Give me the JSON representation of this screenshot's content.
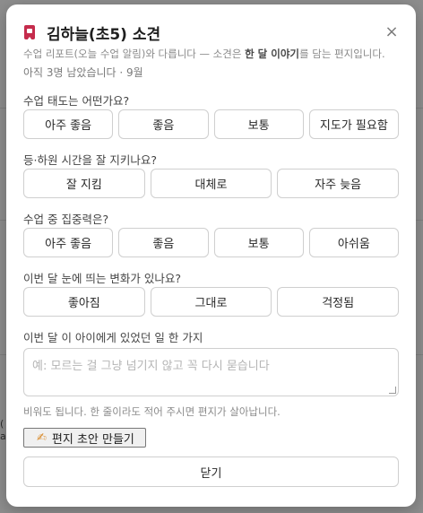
{
  "modal": {
    "icon": "bookmark-badge-icon",
    "title": "김하늘(초5) 소견",
    "close_glyph": "×",
    "description_pre": "수업 리포트(오늘 수업 알림)와 다릅니다 — 소견은 ",
    "description_bold": "한 달 이야기",
    "description_post": "를 담는 편지입니다.",
    "meta": "아직 3명 남았습니다 · 9월"
  },
  "questions": [
    {
      "label": "수업 태도는 어떤가요?",
      "options": [
        "아주 좋음",
        "좋음",
        "보통",
        "지도가 필요함"
      ]
    },
    {
      "label": "등·하원 시간을 잘 지키나요?",
      "options": [
        "잘 지킴",
        "대체로",
        "자주 늦음"
      ]
    },
    {
      "label": "수업 중 집중력은?",
      "options": [
        "아주 좋음",
        "좋음",
        "보통",
        "아쉬움"
      ]
    },
    {
      "label": "이번 달 눈에 띄는 변화가 있나요?",
      "options": [
        "좋아짐",
        "그대로",
        "걱정됨"
      ]
    }
  ],
  "story": {
    "label": "이번 달 이 아이에게 있었던 일 한 가지",
    "placeholder": "예: 모르는 걸 그냥 넘기지 않고 꼭 다시 묻습니다"
  },
  "hint": "비워도 됩니다. 한 줄이라도 적어 주시면 편지가 살아납니다.",
  "draft_button": {
    "icon": "writing-hand-icon",
    "glyph": "✍",
    "label": "편지 초안 만들기"
  },
  "close_button": {
    "label": "닫기"
  },
  "background": {
    "fragment_lines": [
      "(",
      "a"
    ]
  }
}
